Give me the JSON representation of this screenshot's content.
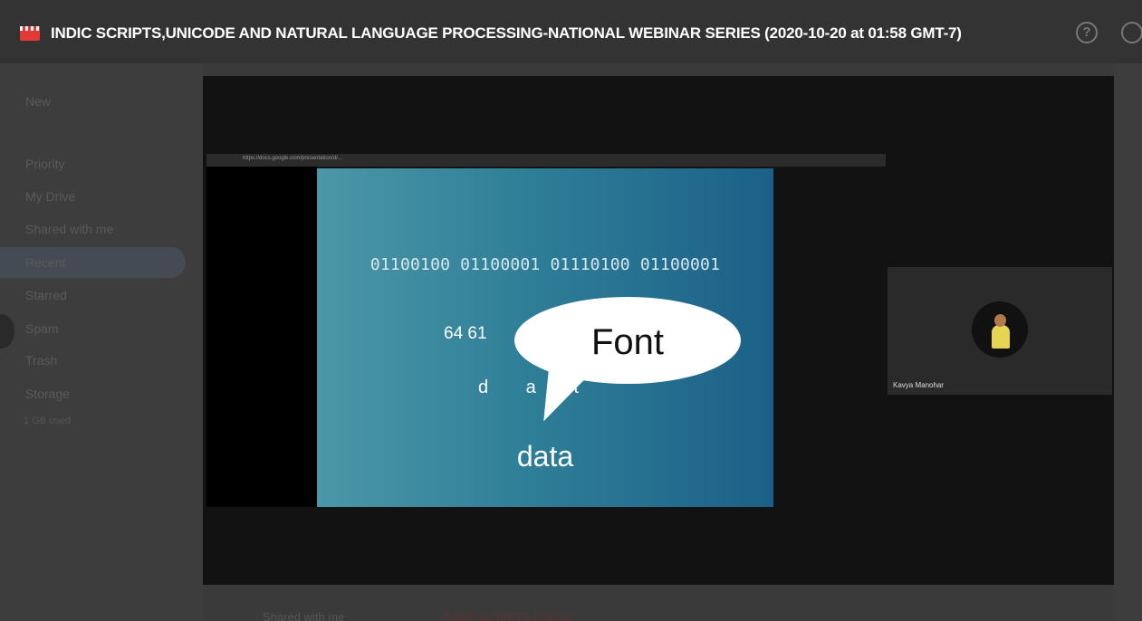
{
  "window": {
    "title": "INDIC SCRIPTS,UNICODE AND NATURAL LANGUAGE PROCESSING-NATIONAL WEBINAR SERIES (2020-10-20 at 01:58 GMT-7)",
    "help_glyph": "?"
  },
  "sidebar": {
    "items": [
      {
        "label": "New"
      },
      {
        "label": "Priority"
      },
      {
        "label": "My Drive"
      },
      {
        "label": "Shared with me"
      },
      {
        "label": "Recent"
      },
      {
        "label": "Starred"
      },
      {
        "label": "Spam"
      },
      {
        "label": "Trash"
      },
      {
        "label": "Storage"
      }
    ],
    "storage_text": "1 GB used"
  },
  "footer": {
    "location": "Shared with me",
    "file": "INDIC SCRIPTS UNICO"
  },
  "video": {
    "browser_url": "https://docs.google.com/presentation/d/...",
    "slide": {
      "binary": "01100100 01100001 01110100 01100001",
      "hex": "64  61",
      "letters": "d a t",
      "bubble_text": "Font",
      "word": "data"
    },
    "participant": {
      "name": "Kavya Manohar"
    }
  },
  "colors": {
    "slide_gradient_start": "#4c97a7",
    "slide_gradient_end": "#1c6088",
    "recording_icon": "#e53935"
  }
}
